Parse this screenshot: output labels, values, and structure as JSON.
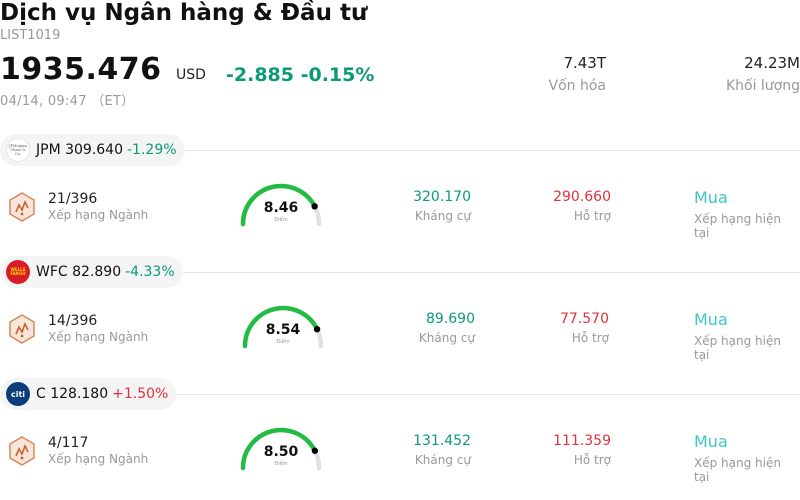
{
  "header": {
    "title": "Dịch vụ Ngân hàng & Đầu tư",
    "code": "LIST1019",
    "price": "1935.476",
    "currency": "USD",
    "change": "-2.885 -0.15%",
    "time": "04/14, 09:47 （ET）",
    "market_cap_value": "7.43T",
    "market_cap_label": "Vốn hóa",
    "volume_value": "24.23M",
    "volume_label": "Khối lượng"
  },
  "colors": {
    "negative_change": "#0a9a78",
    "positive_change": "#e0313c",
    "gauge_fill": "#22bb44",
    "gauge_track": "#dde0e4",
    "rating": "#3fc6c0"
  },
  "stocks": [
    {
      "ticker_line": "JPM 309.640",
      "pct": "-1.29%",
      "direction": "down",
      "logo_icon": "jpmorgan-logo-icon",
      "logo_text": "JPMorgan Chase & Co.",
      "rank": "21/396",
      "rank_label": "Xếp hạng Ngành",
      "score": "8.46",
      "score_value": 8.46,
      "score_label": "Điểm",
      "resistance": "320.170",
      "resistance_label": "Kháng cự",
      "support": "290.660",
      "support_label": "Hỗ trợ",
      "rating": "Mua",
      "rating_label": "Xếp hạng hiện tại"
    },
    {
      "ticker_line": "WFC 82.890",
      "pct": "-4.33%",
      "direction": "down",
      "logo_icon": "wells-fargo-logo-icon",
      "logo_text": "WELLS FARGO",
      "rank": "14/396",
      "rank_label": "Xếp hạng Ngành",
      "score": "8.54",
      "score_value": 8.54,
      "score_label": "Điểm",
      "resistance": "89.690",
      "resistance_label": "Kháng cự",
      "support": "77.570",
      "support_label": "Hỗ trợ",
      "rating": "Mua",
      "rating_label": "Xếp hạng hiện tại"
    },
    {
      "ticker_line": "C 128.180",
      "pct": "+1.50%",
      "direction": "up",
      "logo_icon": "citi-logo-icon",
      "logo_text": "citi",
      "rank": "4/117",
      "rank_label": "Xếp hạng Ngành",
      "score": "8.50",
      "score_value": 8.5,
      "score_label": "Điểm",
      "resistance": "131.452",
      "resistance_label": "Kháng cự",
      "support": "111.359",
      "support_label": "Hỗ trợ",
      "rating": "Mua",
      "rating_label": "Xếp hạng hiện tại"
    }
  ]
}
